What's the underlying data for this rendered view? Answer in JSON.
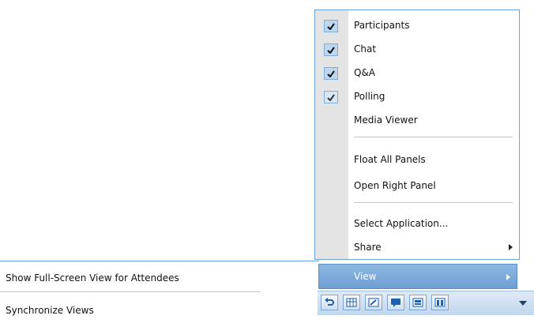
{
  "view_menu": {
    "items": [
      {
        "label": "Participants",
        "checked": true
      },
      {
        "label": "Chat",
        "checked": true
      },
      {
        "label": "Q&A",
        "checked": true
      },
      {
        "label": "Polling",
        "checked": true
      },
      {
        "label": "Media Viewer",
        "checked": false
      },
      {
        "label": "Float All Panels",
        "checked": false
      },
      {
        "label": "Open Right Panel",
        "checked": false
      },
      {
        "label": "Select Application...",
        "checked": false
      },
      {
        "label": "Share",
        "checked": false,
        "has_submenu": true
      }
    ]
  },
  "view_item": {
    "label": "View"
  },
  "left_menu": {
    "items": [
      {
        "label": "Show Full-Screen View for Attendees"
      },
      {
        "label": "Synchronize Views"
      }
    ]
  },
  "toolbar": {
    "icons": [
      "undo-arrow-icon",
      "grid-icon",
      "annotation-icon",
      "chat-bubble-icon",
      "panels-icon",
      "columns-icon",
      "dropdown-arrow-icon"
    ]
  },
  "colors": {
    "accent": "#6e9ed2",
    "border": "#6aa3d8",
    "gutter": "#e4e4e4",
    "check_bg": "#bcd6ef"
  }
}
